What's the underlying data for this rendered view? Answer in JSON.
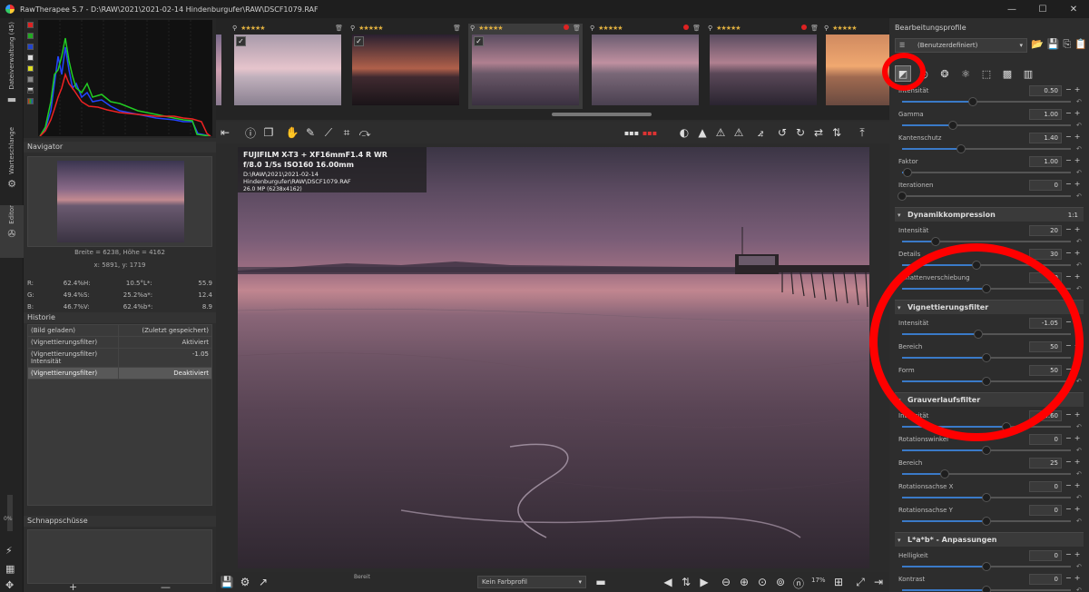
{
  "window": {
    "title": "RawTherapee 5.7 - D:\\RAW\\2021\\2021-02-14 Hindenburgufer\\RAW\\DSCF1079.RAF",
    "btn_min": "—",
    "btn_max": "☐",
    "btn_close": "✕"
  },
  "vtabs": {
    "file_browser": "Dateiverwaltung (45)",
    "queue": "Warteschlange",
    "editor": "Editor"
  },
  "left": {
    "navigator_title": "Navigator",
    "nav_size": "Breite = 6238, Höhe = 4162",
    "nav_pos": "x: 5891, y: 1719",
    "nav_rows": [
      [
        "R:",
        "62.4%",
        "H:",
        "10.5°",
        "L*:",
        "55.9"
      ],
      [
        "G:",
        "49.4%",
        "S:",
        "25.2%",
        "a*:",
        "12.4"
      ],
      [
        "B:",
        "46.7%",
        "V:",
        "62.4%",
        "b*:",
        "8.9"
      ]
    ],
    "history_title": "Historie",
    "history": [
      {
        "a": "(Bild geladen)",
        "b": "(Zuletzt gespeichert)"
      },
      {
        "a": "(Vignettierungsfilter)",
        "b": "Aktiviert"
      },
      {
        "a": "(Vignettierungsfilter) Intensität",
        "b": "-1.05"
      },
      {
        "a": "(Vignettierungsfilter)",
        "b": "Deaktiviert"
      }
    ],
    "snapshots_title": "Schnappschüsse",
    "snap_add": "+",
    "snap_remove": "—",
    "zoom_pct": "0%"
  },
  "filmstrip": {
    "stars": "★★★★★"
  },
  "image": {
    "camera": "FUJIFILM X-T3 + XF16mmF1.4 R WR",
    "exposure": "f/8.0  1/5s  ISO160  16.00mm",
    "path": "D:\\RAW\\2021\\2021-02-14 Hindenburgufer\\RAW\\DSCF1079.RAF",
    "megapixels": "26.0 MP (6238x4162)"
  },
  "status": {
    "ready": "Bereit",
    "color_profile": "Kein Farbprofil",
    "zoom": "17%"
  },
  "right": {
    "profiles_title": "Bearbeitungsprofile",
    "profile_value": "(Benutzerdefiniert)",
    "params_top": [
      {
        "label": "Intensität",
        "value": "0.50",
        "pos": 0.42
      },
      {
        "label": "Gamma",
        "value": "1.00",
        "pos": 0.3
      },
      {
        "label": "Kantenschutz",
        "value": "1.40",
        "pos": 0.35
      },
      {
        "label": "Faktor",
        "value": "1.00",
        "pos": 0.03
      },
      {
        "label": "Iterationen",
        "value": "0",
        "pos": 0.0
      }
    ],
    "dyn_title": "Dynamikkompression",
    "dyn_right": "1:1",
    "dyn_params": [
      {
        "label": "Intensität",
        "value": "20",
        "pos": 0.2
      },
      {
        "label": "Details",
        "value": "30",
        "pos": 0.44
      },
      {
        "label": "Schattenverschiebung",
        "value": "50",
        "pos": 0.5
      }
    ],
    "vig_title": "Vignettierungsfilter",
    "vig_params": [
      {
        "label": "Intensität",
        "value": "-1.05",
        "pos": 0.45
      },
      {
        "label": "Bereich",
        "value": "50",
        "pos": 0.5
      },
      {
        "label": "Form",
        "value": "50",
        "pos": 0.5
      }
    ],
    "grad_title": "Grauverlaufsfilter",
    "grad_params": [
      {
        "label": "Intensität",
        "value": "0.60",
        "pos": 0.62
      },
      {
        "label": "Rotationswinkel",
        "value": "0",
        "pos": 0.5
      },
      {
        "label": "Bereich",
        "value": "25",
        "pos": 0.25
      },
      {
        "label": "Rotationsachse X",
        "value": "0",
        "pos": 0.5
      },
      {
        "label": "Rotationsachse Y",
        "value": "0",
        "pos": 0.5
      }
    ],
    "lab_title": "L*a*b* - Anpassungen",
    "lab_params": [
      {
        "label": "Helligkeit",
        "value": "0",
        "pos": 0.5
      },
      {
        "label": "Kontrast",
        "value": "0",
        "pos": 0.5
      }
    ]
  },
  "colors": {
    "accent": "#3a7ac8",
    "annotation": "#ff0000",
    "star": "#e0b040"
  }
}
